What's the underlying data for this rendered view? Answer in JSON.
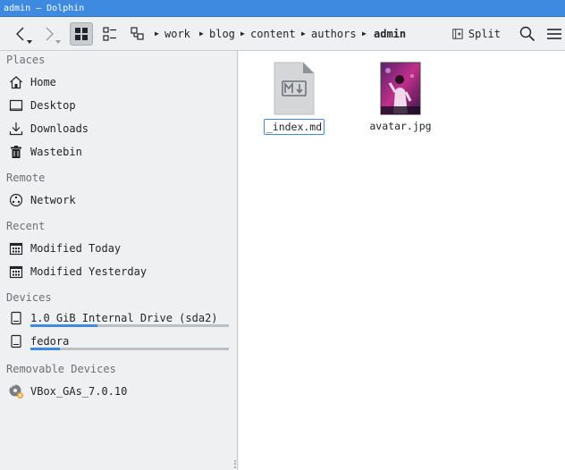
{
  "window": {
    "title": "admin — Dolphin"
  },
  "toolbar": {
    "back_icon": "chevron-left-icon",
    "forward_icon": "chevron-right-icon",
    "view_modes": [
      "icons-view",
      "compact-view",
      "details-view"
    ],
    "breadcrumb": [
      "work",
      "blog",
      "content",
      "authors",
      "admin"
    ],
    "split_label": "Split",
    "search_icon": "search-icon",
    "menu_icon": "hamburger-menu-icon"
  },
  "sidebar": {
    "groups": [
      {
        "title": "Places",
        "items": [
          {
            "label": "Home",
            "icon": "home-icon"
          },
          {
            "label": "Desktop",
            "icon": "desktop-icon"
          },
          {
            "label": "Downloads",
            "icon": "download-icon"
          },
          {
            "label": "Wastebin",
            "icon": "trash-icon"
          }
        ]
      },
      {
        "title": "Remote",
        "items": [
          {
            "label": "Network",
            "icon": "network-icon"
          }
        ]
      },
      {
        "title": "Recent",
        "items": [
          {
            "label": "Modified Today",
            "icon": "calendar-icon"
          },
          {
            "label": "Modified Yesterday",
            "icon": "calendar-icon"
          }
        ]
      },
      {
        "title": "Devices",
        "items": [
          {
            "label": "1.0 GiB Internal Drive (sda2)",
            "icon": "drive-icon",
            "usage": 0.34
          },
          {
            "label": "fedora",
            "icon": "drive-icon",
            "usage": 0.15
          }
        ]
      },
      {
        "title": "Removable Devices",
        "items": [
          {
            "label": "VBox_GAs_7.0.10",
            "icon": "optical-disc-icon"
          }
        ]
      }
    ]
  },
  "files": [
    {
      "name": "_index.md",
      "icon": "markdown-file-icon",
      "renaming": true
    },
    {
      "name": "avatar.jpg",
      "icon": "image-thumbnail"
    }
  ],
  "colors": {
    "accent": "#3d8ae0",
    "titlebar": "#3d8ae0"
  }
}
